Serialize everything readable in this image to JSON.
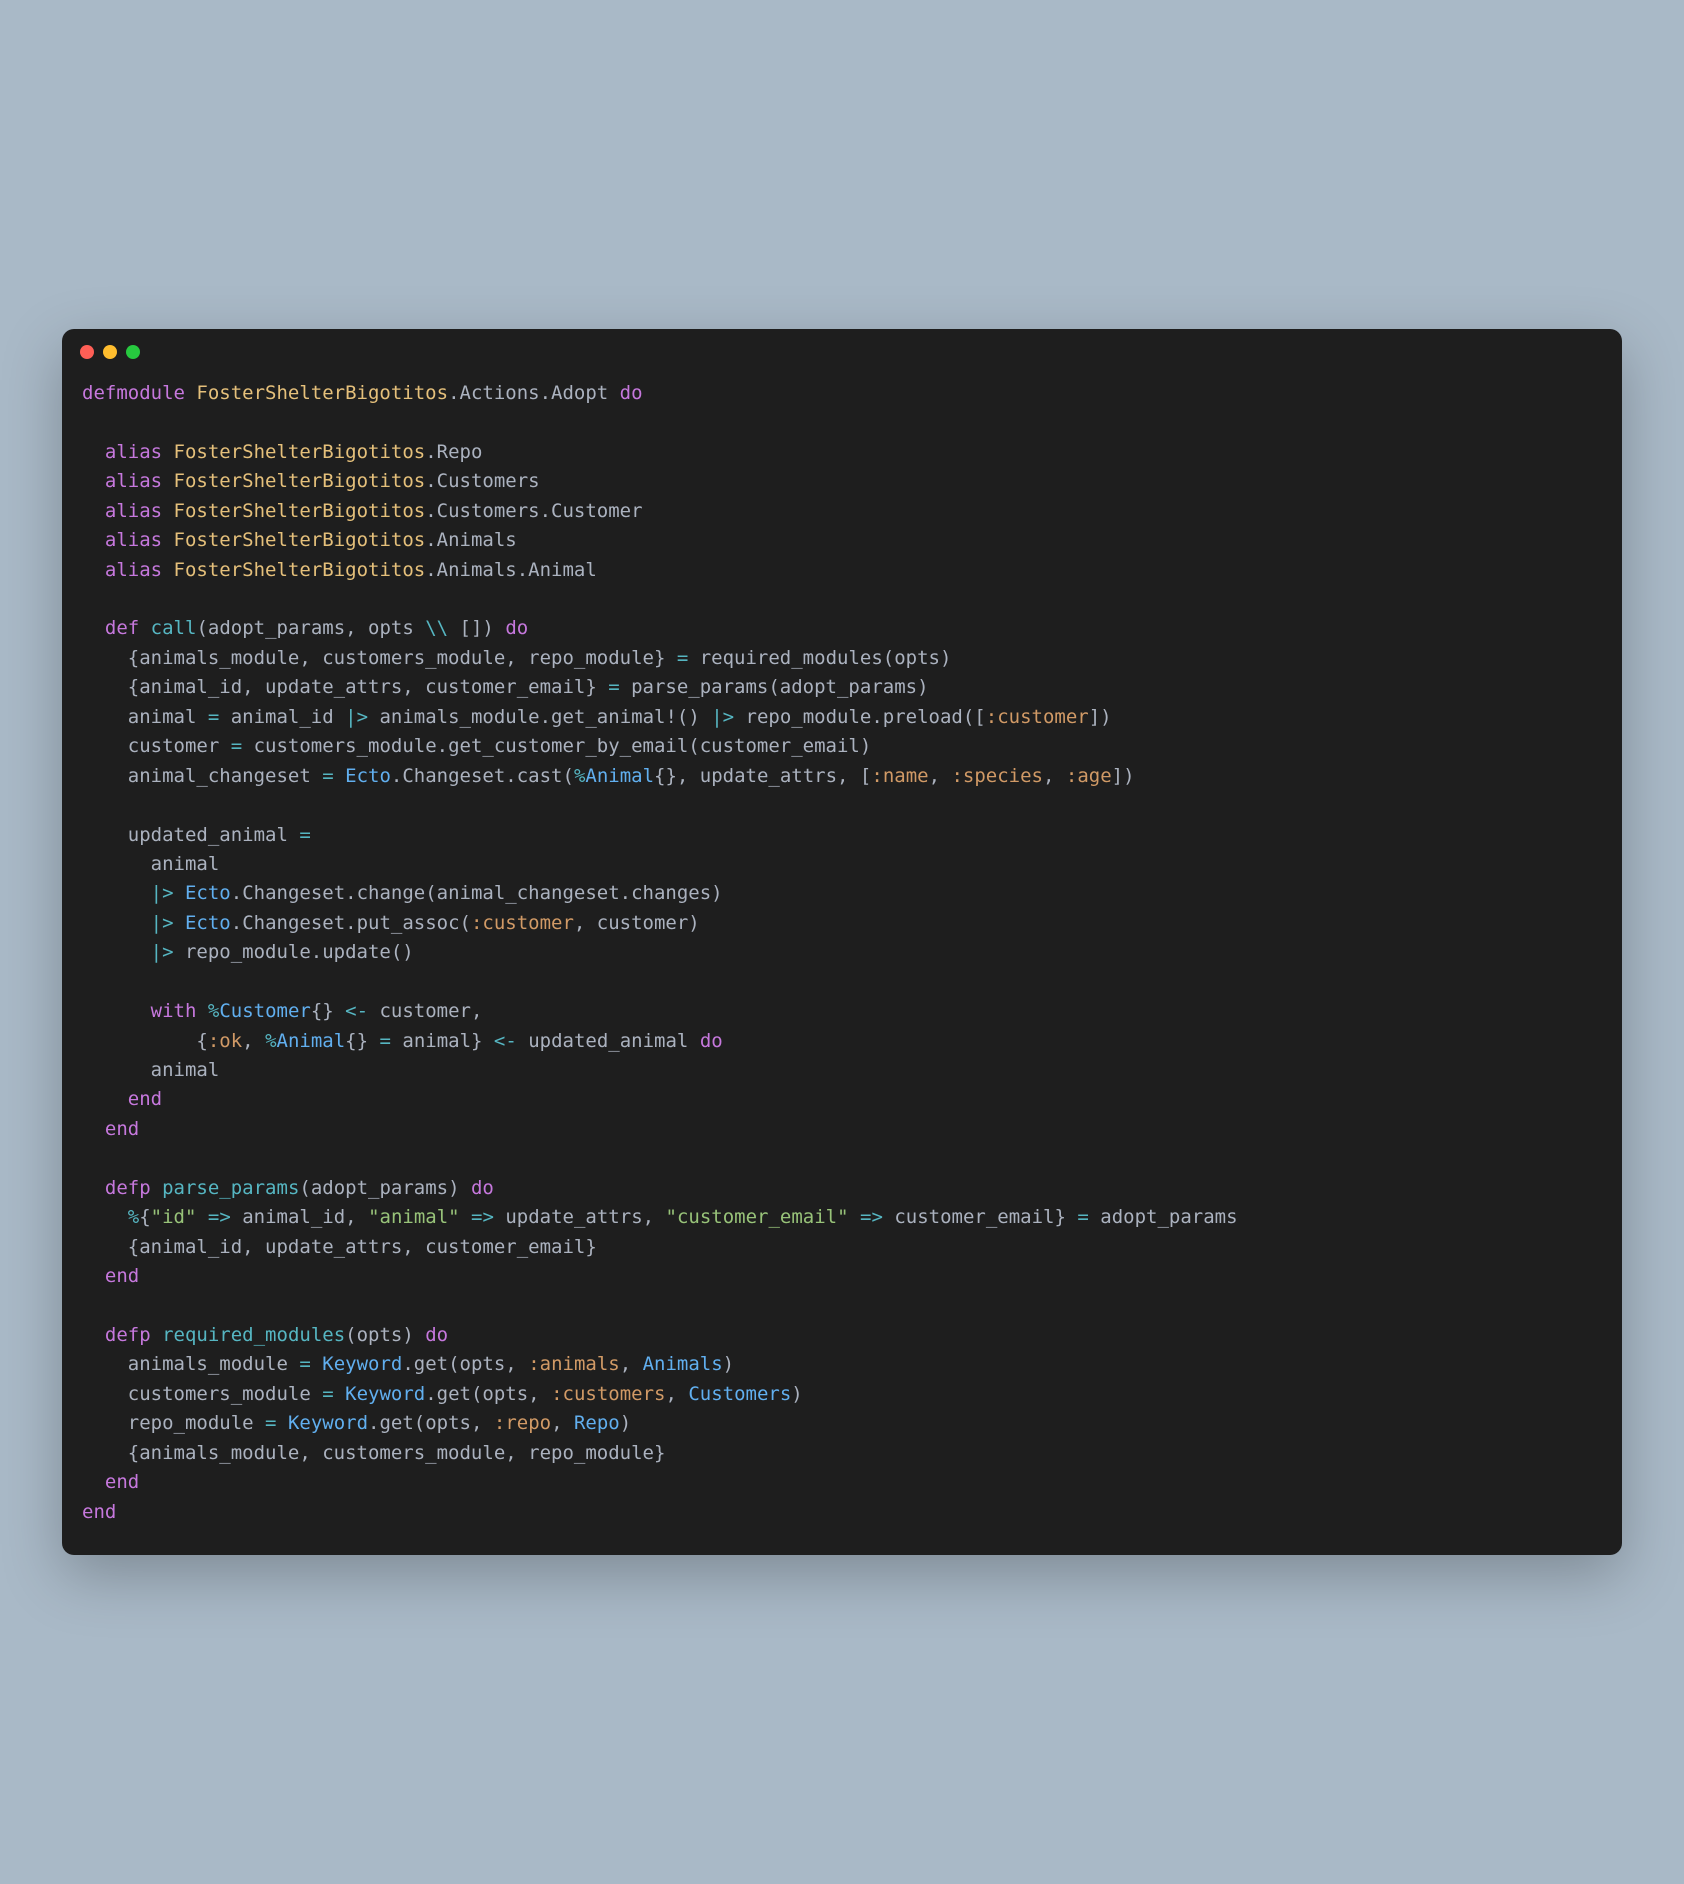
{
  "colors": {
    "bg_page": "#a9b9c7",
    "bg_window": "#1e1e1e",
    "dot_red": "#ff5f56",
    "dot_yellow": "#ffbd2e",
    "dot_green": "#27c93f",
    "keyword": "#c678dd",
    "module": "#e5c07b",
    "module_alt": "#61afef",
    "string": "#98c379",
    "atom": "#d19a66",
    "default": "#cfd0d2",
    "number": "#d19a66"
  },
  "language": "elixir",
  "code_lines": [
    [
      [
        "kw",
        "defmodule"
      ],
      [
        "d",
        " "
      ],
      [
        "mod",
        "FosterShelterBigotitos"
      ],
      [
        "d",
        ".Actions.Adopt "
      ],
      [
        "kw",
        "do"
      ]
    ],
    [
      [
        "d",
        ""
      ]
    ],
    [
      [
        "d",
        "  "
      ],
      [
        "kw",
        "alias"
      ],
      [
        "d",
        " "
      ],
      [
        "mod",
        "FosterShelterBigotitos"
      ],
      [
        "d",
        ".Repo"
      ]
    ],
    [
      [
        "d",
        "  "
      ],
      [
        "kw",
        "alias"
      ],
      [
        "d",
        " "
      ],
      [
        "mod",
        "FosterShelterBigotitos"
      ],
      [
        "d",
        ".Customers"
      ]
    ],
    [
      [
        "d",
        "  "
      ],
      [
        "kw",
        "alias"
      ],
      [
        "d",
        " "
      ],
      [
        "mod",
        "FosterShelterBigotitos"
      ],
      [
        "d",
        ".Customers.Customer"
      ]
    ],
    [
      [
        "d",
        "  "
      ],
      [
        "kw",
        "alias"
      ],
      [
        "d",
        " "
      ],
      [
        "mod",
        "FosterShelterBigotitos"
      ],
      [
        "d",
        ".Animals"
      ]
    ],
    [
      [
        "d",
        "  "
      ],
      [
        "kw",
        "alias"
      ],
      [
        "d",
        " "
      ],
      [
        "mod",
        "FosterShelterBigotitos"
      ],
      [
        "d",
        ".Animals.Animal"
      ]
    ],
    [
      [
        "d",
        ""
      ]
    ],
    [
      [
        "d",
        "  "
      ],
      [
        "kw",
        "def"
      ],
      [
        "d",
        " "
      ],
      [
        "fn",
        "call"
      ],
      [
        "d",
        "(adopt_params, opts "
      ],
      [
        "op",
        "\\\\"
      ],
      [
        "d",
        " []) "
      ],
      [
        "kw",
        "do"
      ]
    ],
    [
      [
        "d",
        "    {animals_module, customers_module, repo_module} "
      ],
      [
        "op",
        "="
      ],
      [
        "d",
        " required_modules(opts)"
      ]
    ],
    [
      [
        "d",
        "    {animal_id, update_attrs, customer_email} "
      ],
      [
        "op",
        "="
      ],
      [
        "d",
        " parse_params(adopt_params)"
      ]
    ],
    [
      [
        "d",
        "    animal "
      ],
      [
        "op",
        "="
      ],
      [
        "d",
        " animal_id "
      ],
      [
        "op",
        "|>"
      ],
      [
        "d",
        " animals_module.get_animal!() "
      ],
      [
        "op",
        "|>"
      ],
      [
        "d",
        " repo_module.preload(["
      ],
      [
        "atom",
        ":customer"
      ],
      [
        "d",
        "])"
      ]
    ],
    [
      [
        "d",
        "    customer "
      ],
      [
        "op",
        "="
      ],
      [
        "d",
        " customers_module.get_customer_by_email(customer_email)"
      ]
    ],
    [
      [
        "d",
        "    animal_changeset "
      ],
      [
        "op",
        "="
      ],
      [
        "d",
        " "
      ],
      [
        "mod2",
        "Ecto"
      ],
      [
        "d",
        ".Changeset.cast("
      ],
      [
        "op",
        "%"
      ],
      [
        "mod2",
        "Animal"
      ],
      [
        "d",
        "{}, update_attrs, ["
      ],
      [
        "atom",
        ":name"
      ],
      [
        "d",
        ", "
      ],
      [
        "atom",
        ":species"
      ],
      [
        "d",
        ", "
      ],
      [
        "atom",
        ":age"
      ],
      [
        "d",
        "])"
      ]
    ],
    [
      [
        "d",
        ""
      ]
    ],
    [
      [
        "d",
        "    updated_animal "
      ],
      [
        "op",
        "="
      ]
    ],
    [
      [
        "d",
        "      animal"
      ]
    ],
    [
      [
        "d",
        "      "
      ],
      [
        "op",
        "|>"
      ],
      [
        "d",
        " "
      ],
      [
        "mod2",
        "Ecto"
      ],
      [
        "d",
        ".Changeset.change(animal_changeset.changes)"
      ]
    ],
    [
      [
        "d",
        "      "
      ],
      [
        "op",
        "|>"
      ],
      [
        "d",
        " "
      ],
      [
        "mod2",
        "Ecto"
      ],
      [
        "d",
        ".Changeset.put_assoc("
      ],
      [
        "atom",
        ":customer"
      ],
      [
        "d",
        ", customer)"
      ]
    ],
    [
      [
        "d",
        "      "
      ],
      [
        "op",
        "|>"
      ],
      [
        "d",
        " repo_module.update()"
      ]
    ],
    [
      [
        "d",
        ""
      ]
    ],
    [
      [
        "d",
        "      "
      ],
      [
        "kw",
        "with"
      ],
      [
        "d",
        " "
      ],
      [
        "op",
        "%"
      ],
      [
        "mod2",
        "Customer"
      ],
      [
        "d",
        "{} "
      ],
      [
        "op",
        "<-"
      ],
      [
        "d",
        " customer,"
      ]
    ],
    [
      [
        "d",
        "          {"
      ],
      [
        "atom",
        ":ok"
      ],
      [
        "d",
        ", "
      ],
      [
        "op",
        "%"
      ],
      [
        "mod2",
        "Animal"
      ],
      [
        "d",
        "{} "
      ],
      [
        "op",
        "="
      ],
      [
        "d",
        " animal} "
      ],
      [
        "op",
        "<-"
      ],
      [
        "d",
        " updated_animal "
      ],
      [
        "kw",
        "do"
      ]
    ],
    [
      [
        "d",
        "      animal"
      ]
    ],
    [
      [
        "d",
        "    "
      ],
      [
        "kw",
        "end"
      ]
    ],
    [
      [
        "d",
        "  "
      ],
      [
        "kw",
        "end"
      ]
    ],
    [
      [
        "d",
        ""
      ]
    ],
    [
      [
        "d",
        "  "
      ],
      [
        "kw",
        "defp"
      ],
      [
        "d",
        " "
      ],
      [
        "fn",
        "parse_params"
      ],
      [
        "d",
        "(adopt_params) "
      ],
      [
        "kw",
        "do"
      ]
    ],
    [
      [
        "d",
        "    "
      ],
      [
        "op",
        "%"
      ],
      [
        "d",
        "{"
      ],
      [
        "str",
        "\"id\""
      ],
      [
        "d",
        " "
      ],
      [
        "op",
        "=>"
      ],
      [
        "d",
        " animal_id, "
      ],
      [
        "str",
        "\"animal\""
      ],
      [
        "d",
        " "
      ],
      [
        "op",
        "=>"
      ],
      [
        "d",
        " update_attrs, "
      ],
      [
        "str",
        "\"customer_email\""
      ],
      [
        "d",
        " "
      ],
      [
        "op",
        "=>"
      ],
      [
        "d",
        " customer_email} "
      ],
      [
        "op",
        "="
      ],
      [
        "d",
        " adopt_params"
      ]
    ],
    [
      [
        "d",
        "    {animal_id, update_attrs, customer_email}"
      ]
    ],
    [
      [
        "d",
        "  "
      ],
      [
        "kw",
        "end"
      ]
    ],
    [
      [
        "d",
        ""
      ]
    ],
    [
      [
        "d",
        "  "
      ],
      [
        "kw",
        "defp"
      ],
      [
        "d",
        " "
      ],
      [
        "fn",
        "required_modules"
      ],
      [
        "d",
        "(opts) "
      ],
      [
        "kw",
        "do"
      ]
    ],
    [
      [
        "d",
        "    animals_module "
      ],
      [
        "op",
        "="
      ],
      [
        "d",
        " "
      ],
      [
        "mod2",
        "Keyword"
      ],
      [
        "d",
        ".get(opts, "
      ],
      [
        "atom",
        ":animals"
      ],
      [
        "d",
        ", "
      ],
      [
        "mod2",
        "Animals"
      ],
      [
        "d",
        ")"
      ]
    ],
    [
      [
        "d",
        "    customers_module "
      ],
      [
        "op",
        "="
      ],
      [
        "d",
        " "
      ],
      [
        "mod2",
        "Keyword"
      ],
      [
        "d",
        ".get(opts, "
      ],
      [
        "atom",
        ":customers"
      ],
      [
        "d",
        ", "
      ],
      [
        "mod2",
        "Customers"
      ],
      [
        "d",
        ")"
      ]
    ],
    [
      [
        "d",
        "    repo_module "
      ],
      [
        "op",
        "="
      ],
      [
        "d",
        " "
      ],
      [
        "mod2",
        "Keyword"
      ],
      [
        "d",
        ".get(opts, "
      ],
      [
        "atom",
        ":repo"
      ],
      [
        "d",
        ", "
      ],
      [
        "mod2",
        "Repo"
      ],
      [
        "d",
        ")"
      ]
    ],
    [
      [
        "d",
        "    {animals_module, customers_module, repo_module}"
      ]
    ],
    [
      [
        "d",
        "  "
      ],
      [
        "kw",
        "end"
      ]
    ],
    [
      [
        "kw",
        "end"
      ]
    ]
  ]
}
